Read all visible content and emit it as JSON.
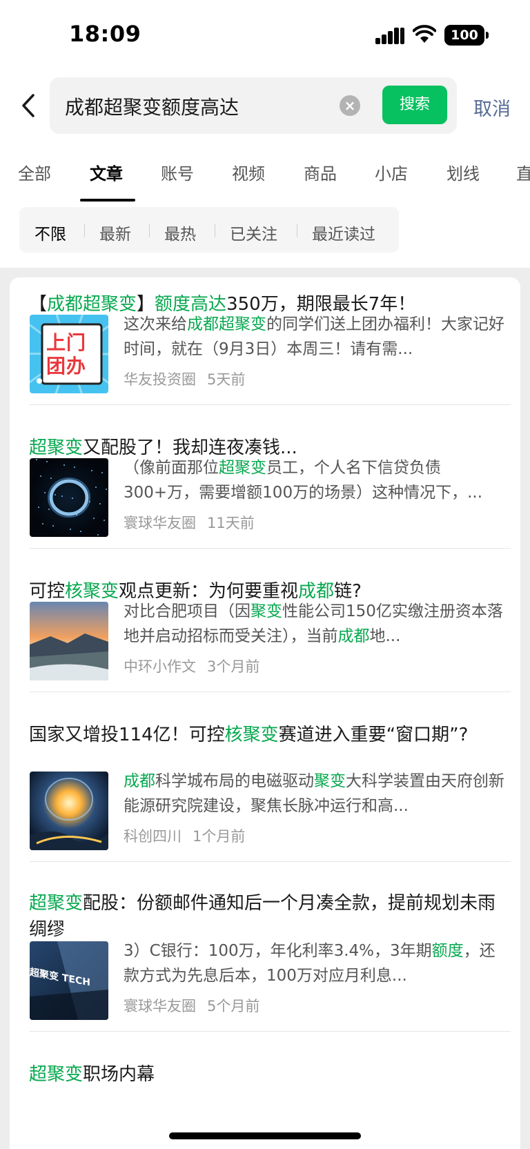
{
  "status": {
    "time": "18:09",
    "battery": "100"
  },
  "search": {
    "query": "成都超聚变额度高达",
    "button": "搜索",
    "cancel": "取消"
  },
  "tabs": [
    "全部",
    "文章",
    "账号",
    "视频",
    "商品",
    "小店",
    "划线",
    "直"
  ],
  "active_tab": "文章",
  "filters": [
    "不限",
    "最新",
    "最热",
    "已关注",
    "最近读过"
  ],
  "active_filter": "不限",
  "colors": {
    "accent": "#07c160",
    "highlight": "#07a84f",
    "link": "#576b95"
  },
  "results": [
    {
      "title": [
        {
          "t": "【"
        },
        {
          "t": "成都超聚变",
          "h": true
        },
        {
          "t": "】"
        },
        {
          "t": "额度高达",
          "h": true
        },
        {
          "t": "350万，期限最长7年！"
        }
      ],
      "snippet": [
        {
          "t": "这次来给"
        },
        {
          "t": "成都超聚变",
          "h": true
        },
        {
          "t": "的同学们送上团办福利！大家记好时间，就在（9月3日）本周三！请有需..."
        }
      ],
      "source": "华友投资圈",
      "time": "5天前",
      "thumb_text": "上门团办",
      "thumb": "flyer"
    },
    {
      "title": [
        {
          "t": "超聚变",
          "h": true
        },
        {
          "t": "又配股了！我却连夜凑钱..."
        }
      ],
      "snippet": [
        {
          "t": "（像前面那位"
        },
        {
          "t": "超聚变",
          "h": true
        },
        {
          "t": "员工，个人名下信贷负债300+万，需要增额100万的场景）这种情况下，..."
        }
      ],
      "source": "寰球华友圈",
      "time": "11天前",
      "thumb": "ring"
    },
    {
      "title": [
        {
          "t": "可控"
        },
        {
          "t": "核聚变",
          "h": true
        },
        {
          "t": "观点更新：为何要重视"
        },
        {
          "t": "成都",
          "h": true
        },
        {
          "t": "链?"
        }
      ],
      "snippet": [
        {
          "t": "对比合肥项目（因"
        },
        {
          "t": "聚变",
          "h": true
        },
        {
          "t": "性能公司150亿实缴注册资本落地并启动招标而受关注），当前"
        },
        {
          "t": "成都",
          "h": true
        },
        {
          "t": "地..."
        }
      ],
      "source": "中环小作文",
      "time": "3个月前",
      "thumb": "landscape"
    },
    {
      "title": [
        {
          "t": "国家又增投114亿！可控"
        },
        {
          "t": "核聚变",
          "h": true
        },
        {
          "t": "赛道进入重要“窗口期”?"
        }
      ],
      "snippet": [
        {
          "t": "成都",
          "h": true
        },
        {
          "t": "科学城布局的电磁驱动"
        },
        {
          "t": "聚变",
          "h": true
        },
        {
          "t": "大科学装置由天府创新能源研究院建设，聚焦长脉冲运行和高..."
        }
      ],
      "source": "科创四川",
      "time": "1个月前",
      "thumb": "sun"
    },
    {
      "title": [
        {
          "t": "超聚变",
          "h": true
        },
        {
          "t": "配股：份额邮件通知后一个月凑全款，提前规划未雨绸缪"
        }
      ],
      "snippet": [
        {
          "t": "3）C银行：100万，年化利率3.4%，3年期"
        },
        {
          "t": "额度",
          "h": true
        },
        {
          "t": "，还款方式为先息后本，100万对应月利息..."
        }
      ],
      "source": "寰球华友圈",
      "time": "5个月前",
      "thumb_text": "超聚变 TECH",
      "thumb": "tech"
    },
    {
      "title": [
        {
          "t": "超聚变",
          "h": true
        },
        {
          "t": "职场内幕"
        }
      ]
    }
  ]
}
